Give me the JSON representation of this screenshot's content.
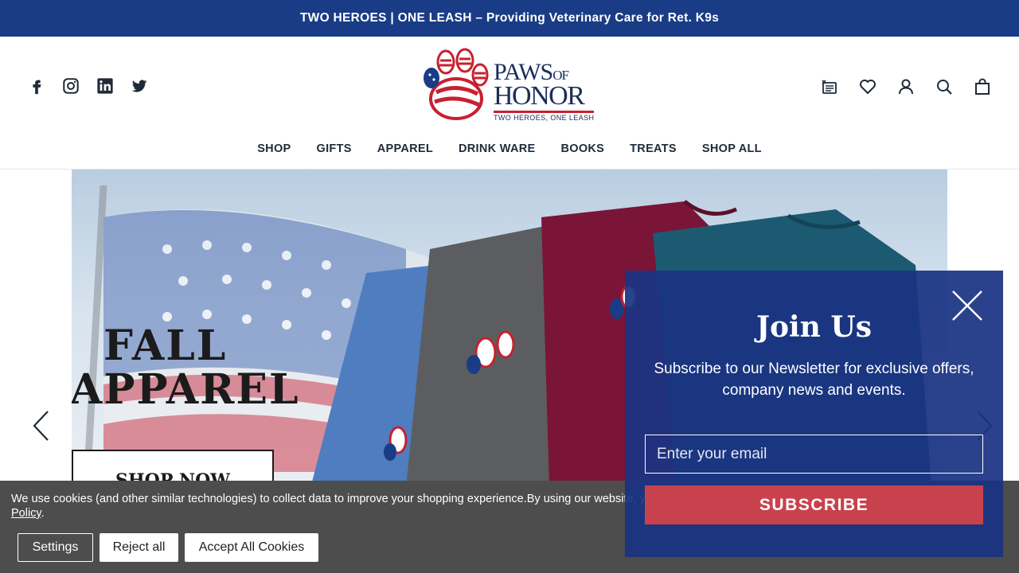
{
  "announcement": "TWO HEROES | ONE LEASH – Providing Veterinary Care for Ret. K9s",
  "logo": {
    "line1": "PAWS",
    "line1_small": "OF",
    "line2": "HONOR",
    "tagline": "TWO HEROES, ONE LEASH"
  },
  "social_icons": [
    "facebook-icon",
    "instagram-icon",
    "linkedin-icon",
    "twitter-icon"
  ],
  "utility_icons": [
    "registry-icon",
    "wishlist-icon",
    "account-icon",
    "search-icon",
    "cart-icon"
  ],
  "nav": {
    "items": [
      "SHOP",
      "GIFTS",
      "APPAREL",
      "DRINK WARE",
      "BOOKS",
      "TREATS",
      "SHOP ALL"
    ]
  },
  "hero": {
    "line1": "FALL",
    "line2": "APPAREL",
    "cta": "SHOP NOW"
  },
  "cookie": {
    "text": "We use cookies (and other similar technologies) to collect data to improve your shopping experience.By using our website, you're agreeing to the collection of data as described in our ",
    "policy_link": "Privacy Policy",
    "period": ".",
    "settings": "Settings",
    "reject": "Reject all",
    "accept": "Accept All Cookies"
  },
  "newsletter": {
    "title": "Join Us",
    "subtitle": "Subscribe to our Newsletter for exclusive offers, company news and events.",
    "email_placeholder": "Enter your email",
    "subscribe": "SUBSCRIBE"
  },
  "colors": {
    "brand_navy": "#1a3c86",
    "brand_red": "#c8202f",
    "subscribe_red": "#c8424d",
    "cookie_bar": "#4d4d4d"
  }
}
